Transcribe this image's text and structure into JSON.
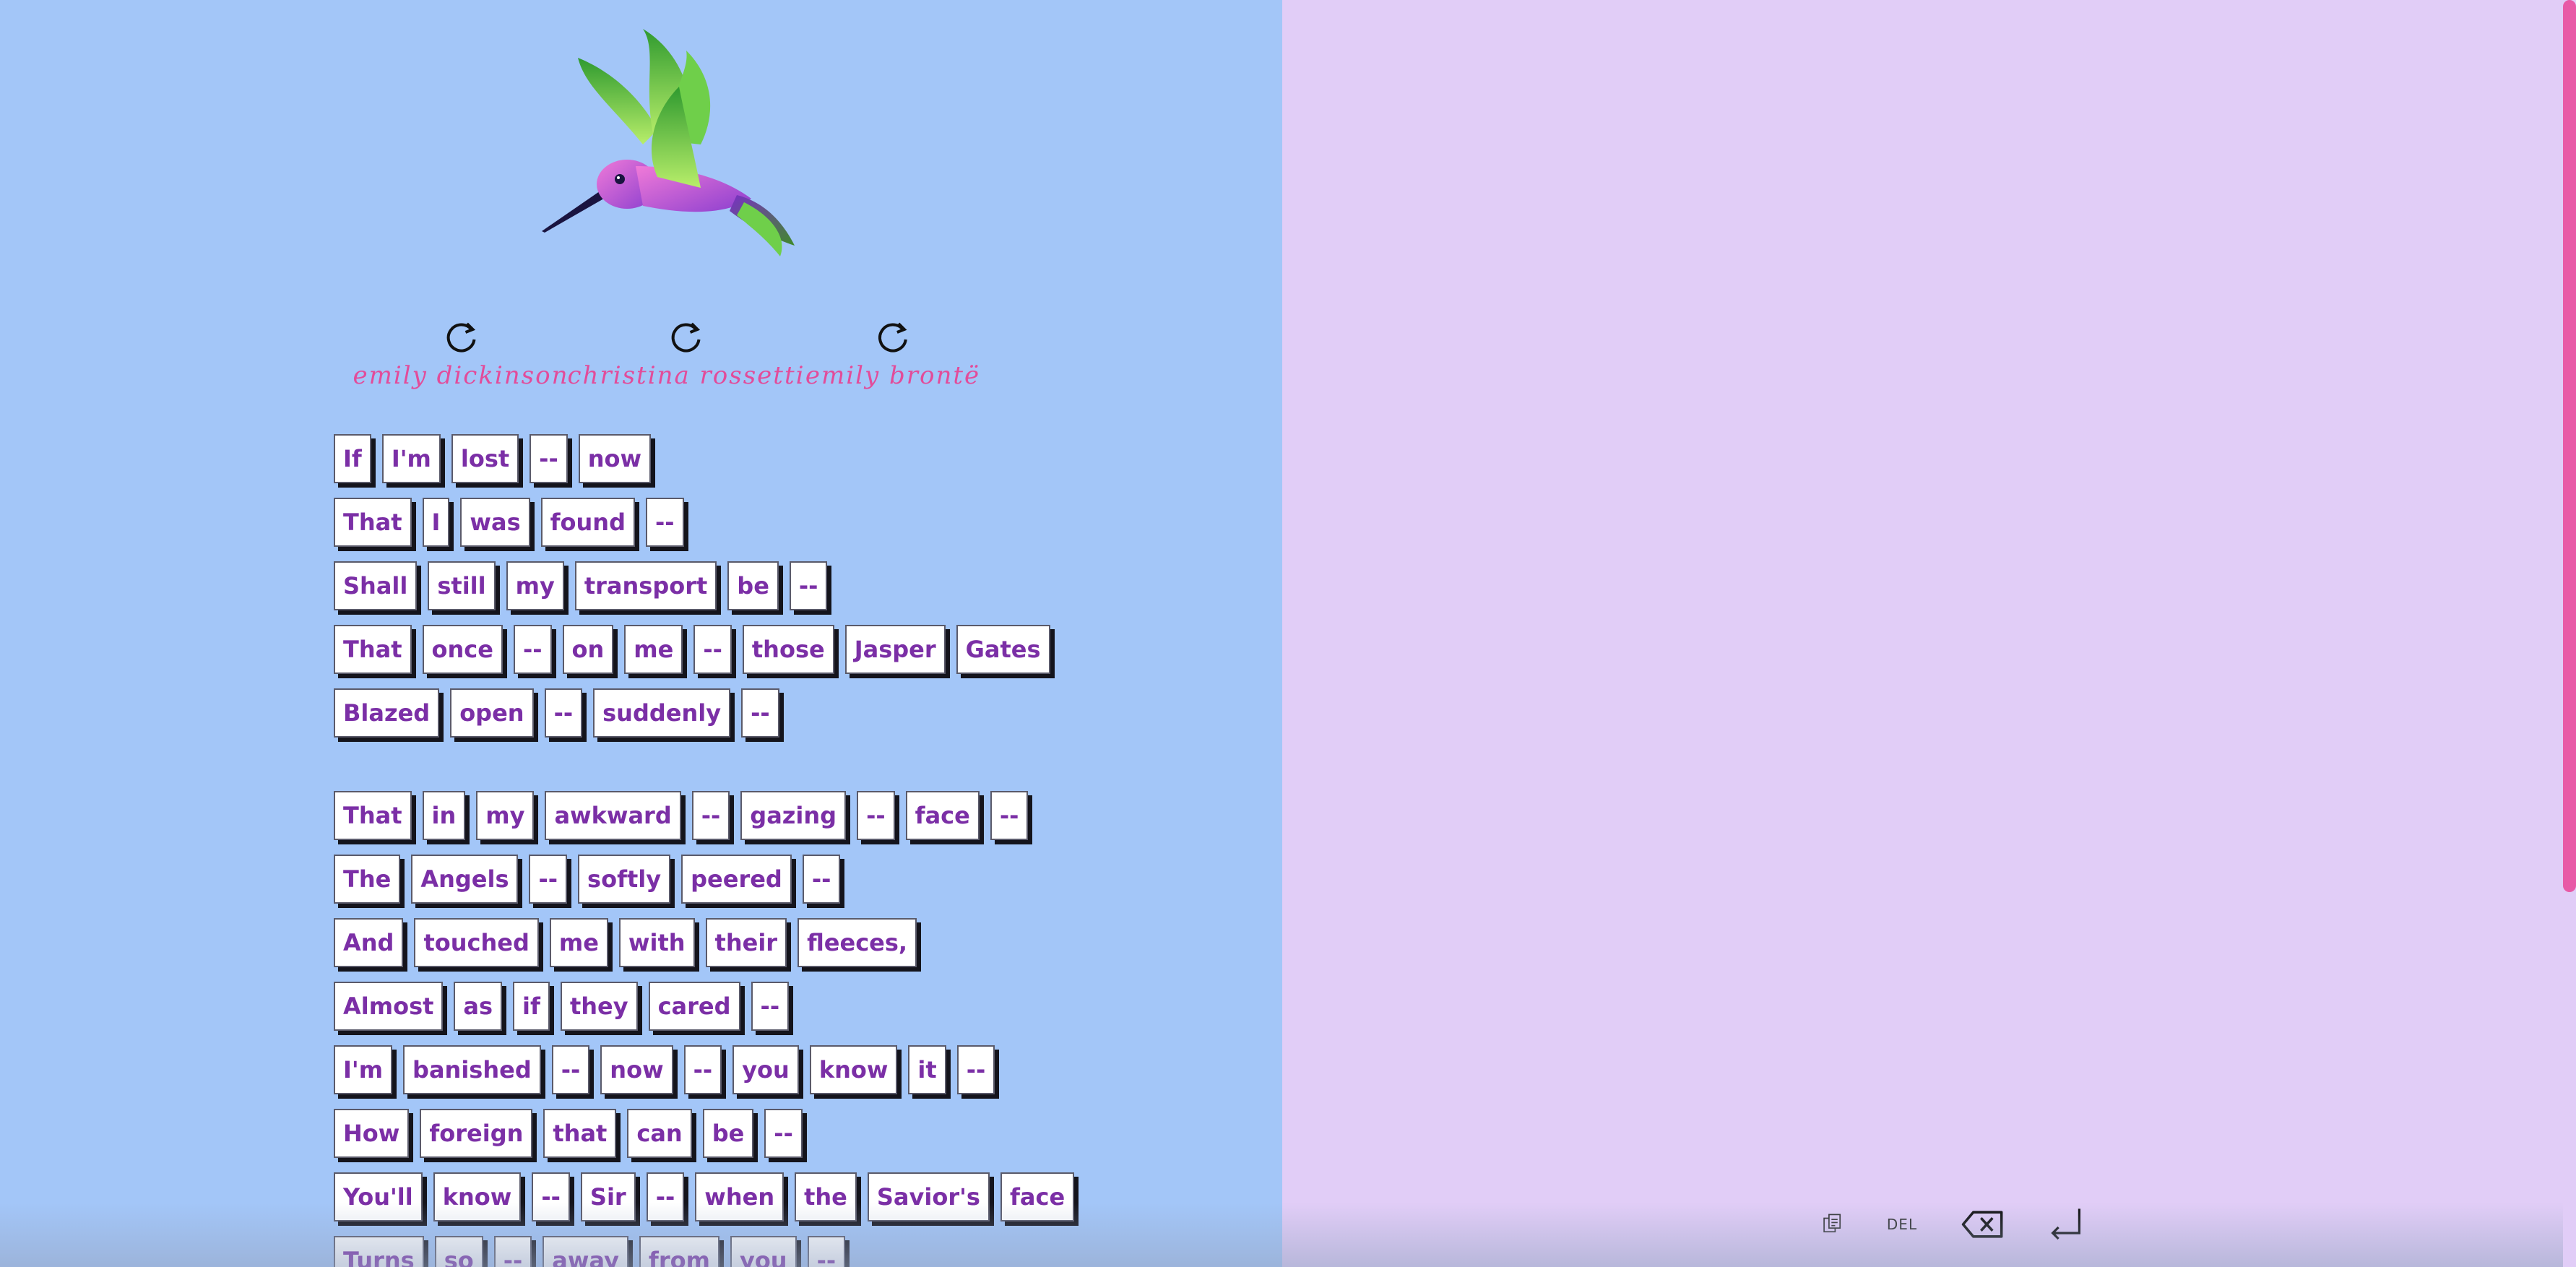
{
  "poets": [
    {
      "name": "emily dickinson"
    },
    {
      "name": "christina rossetti"
    },
    {
      "name": "emily brontë"
    }
  ],
  "poem": {
    "stanzas": [
      [
        [
          "If",
          "I'm",
          "lost",
          "--",
          "now"
        ],
        [
          "That",
          "I",
          "was",
          "found",
          "--"
        ],
        [
          "Shall",
          "still",
          "my",
          "transport",
          "be",
          "--"
        ],
        [
          "That",
          "once",
          "--",
          "on",
          "me",
          "--",
          "those",
          "Jasper",
          "Gates"
        ],
        [
          "Blazed",
          "open",
          "--",
          "suddenly",
          "--"
        ]
      ],
      [
        [
          "That",
          "in",
          "my",
          "awkward",
          "--",
          "gazing",
          "--",
          "face",
          "--"
        ],
        [
          "The",
          "Angels",
          "--",
          "softly",
          "peered",
          "--"
        ],
        [
          "And",
          "touched",
          "me",
          "with",
          "their",
          "fleeces,"
        ],
        [
          "Almost",
          "as",
          "if",
          "they",
          "cared",
          "--"
        ],
        [
          "I'm",
          "banished",
          "--",
          "now",
          "--",
          "you",
          "know",
          "it",
          "--"
        ],
        [
          "How",
          "foreign",
          "that",
          "can",
          "be",
          "--"
        ],
        [
          "You'll",
          "know",
          "--",
          "Sir",
          "--",
          "when",
          "the",
          "Savior's",
          "face"
        ],
        [
          "Turns",
          "so",
          "--",
          "away",
          "from",
          "you",
          "--"
        ]
      ]
    ]
  },
  "toolbar": {
    "copy_icon": "copy-icon",
    "del_label": "DEL",
    "backspace_icon": "backspace-icon",
    "enter_icon": "enter-icon"
  },
  "colors": {
    "left_bg": "#a3c6f8",
    "right_bg": "#e1cdf7",
    "accent_pink": "#e24c9a",
    "word_text": "#7b2fa6",
    "scrollbar": "#e85aa6"
  }
}
